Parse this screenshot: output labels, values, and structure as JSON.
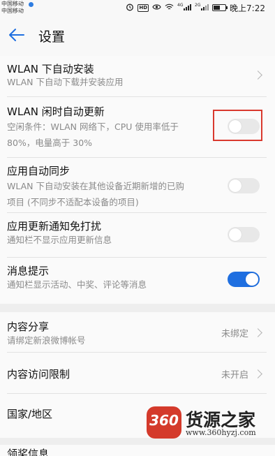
{
  "status_bar": {
    "carrier_1": "中国移动",
    "carrier_2": "中国移动",
    "hd_badge": "HD",
    "net_1": "4G",
    "net_2": "2G",
    "battery_level": 0.55,
    "time": "晚上7:22"
  },
  "header": {
    "title": "设置"
  },
  "settings": {
    "wlan_auto_install": {
      "title": "WLAN 下自动安装",
      "subtitle": "WLAN 下自动下载并安装应用"
    },
    "wlan_idle_update": {
      "title": "WLAN 闲时自动更新",
      "subtitle_line1": "空闲条件：WLAN 网络下，CPU 使用率低于",
      "subtitle_line2": "80%，电量高于 30%",
      "enabled": false
    },
    "app_auto_sync": {
      "title": "应用自动同步",
      "subtitle_line1": "WLAN 下自动安装在其他设备近期新增的已购",
      "subtitle_line2": "项目 (不同步不适配本设备的项目)",
      "enabled": false
    },
    "update_notify_dnd": {
      "title": "应用更新通知免打扰",
      "subtitle": "通知栏不显示应用更新信息",
      "enabled": false
    },
    "message_prompt": {
      "title": "消息提示",
      "subtitle": "通知栏显示活动、中奖、评论等消息",
      "enabled": true
    },
    "content_share": {
      "title": "内容分享",
      "subtitle": "请绑定新浪微博帐号",
      "value": "未绑定"
    },
    "content_access": {
      "title": "内容访问限制",
      "value": "未开启"
    },
    "region": {
      "title": "国家/地区"
    },
    "partial_last": {
      "title": "领奖信息"
    }
  },
  "watermark": {
    "logo_text": "360",
    "title": "货源之家",
    "url": "www.360hyzj.com"
  },
  "colors": {
    "accent": "#1f6fe0",
    "highlight": "#d9392e"
  }
}
